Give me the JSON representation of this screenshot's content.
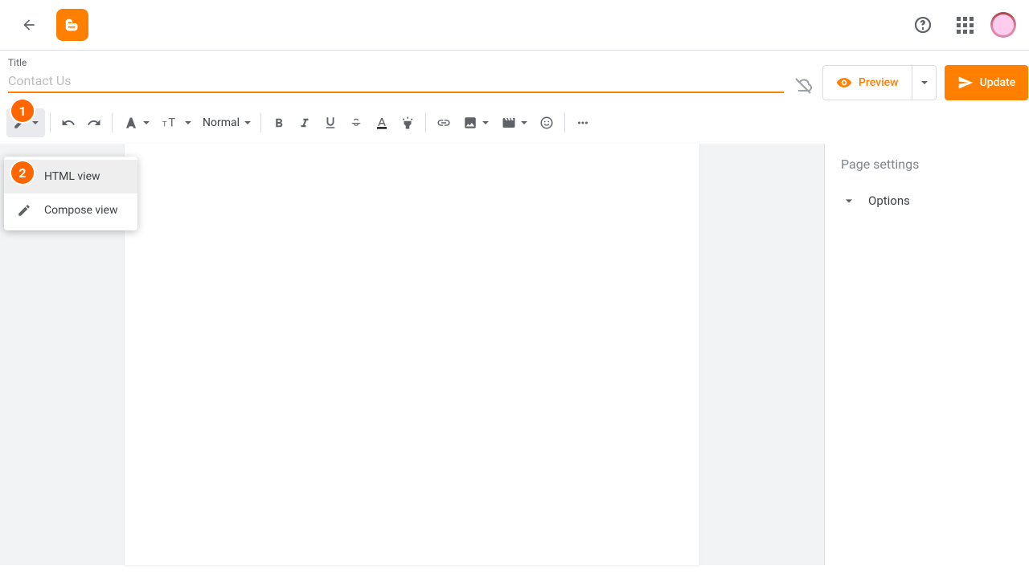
{
  "header": {
    "back_icon": "arrow-left",
    "logo_letter": "B"
  },
  "title": {
    "label": "Title",
    "value": "Contact Us"
  },
  "actions": {
    "preview_label": "Preview",
    "update_label": "Update"
  },
  "toolbar": {
    "paragraph_style": "Normal"
  },
  "view_menu": {
    "items": [
      {
        "label": "HTML view",
        "icon": "code"
      },
      {
        "label": "Compose view",
        "icon": "pencil"
      }
    ]
  },
  "settings": {
    "heading": "Page settings",
    "options_label": "Options"
  },
  "annotations": {
    "badge1": "1",
    "badge2": "2"
  }
}
